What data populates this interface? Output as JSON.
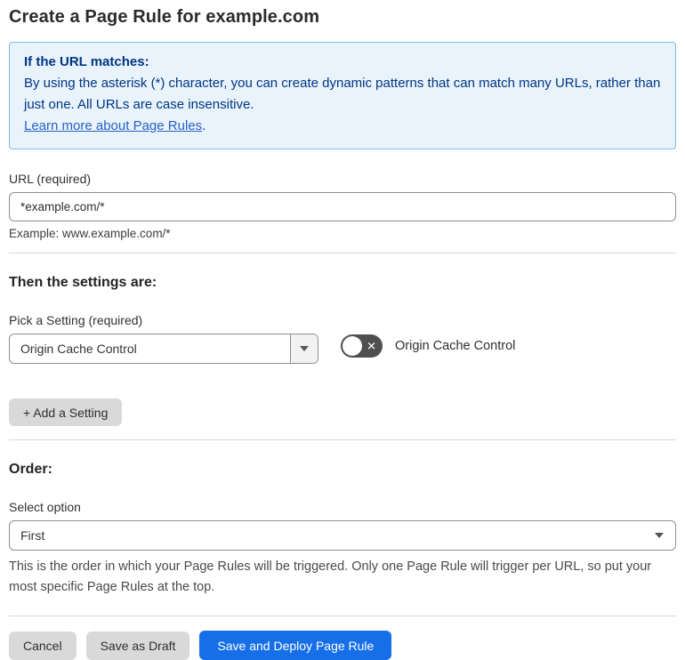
{
  "page": {
    "title": "Create a Page Rule for example.com"
  },
  "info_box": {
    "heading": "If the URL matches:",
    "body": "By using the asterisk (*) character, you can create dynamic patterns that can match many URLs, rather than just one. All URLs are case insensitive.",
    "link": "Learn more about Page Rules",
    "link_suffix": "."
  },
  "url_field": {
    "label": "URL (required)",
    "value": "*example.com/*",
    "example": "Example: www.example.com/*"
  },
  "settings_section": {
    "heading": "Then the settings are:",
    "pick_label": "Pick a Setting (required)",
    "selected_setting": "Origin Cache Control",
    "toggle_label": "Origin Cache Control",
    "toggle_state": "off",
    "toggle_icon": "✕",
    "add_button": "+ Add a Setting"
  },
  "order_section": {
    "heading": "Order:",
    "select_label": "Select option",
    "selected_option": "First",
    "help": "This is the order in which your Page Rules will be triggered. Only one Page Rule will trigger per URL, so put your most specific Page Rules at the top."
  },
  "footer": {
    "cancel": "Cancel",
    "save_draft": "Save as Draft",
    "save_deploy": "Save and Deploy Page Rule"
  },
  "colors": {
    "info_bg": "#e9f3fc",
    "info_border": "#7fbce9",
    "info_text": "#003682",
    "link_blue": "#2962c4",
    "accent_blue": "#166fe8",
    "toggle_off_bg": "#4f4f4f",
    "gray_button_bg": "#d9d9d9",
    "divider": "#d6d6d6"
  }
}
